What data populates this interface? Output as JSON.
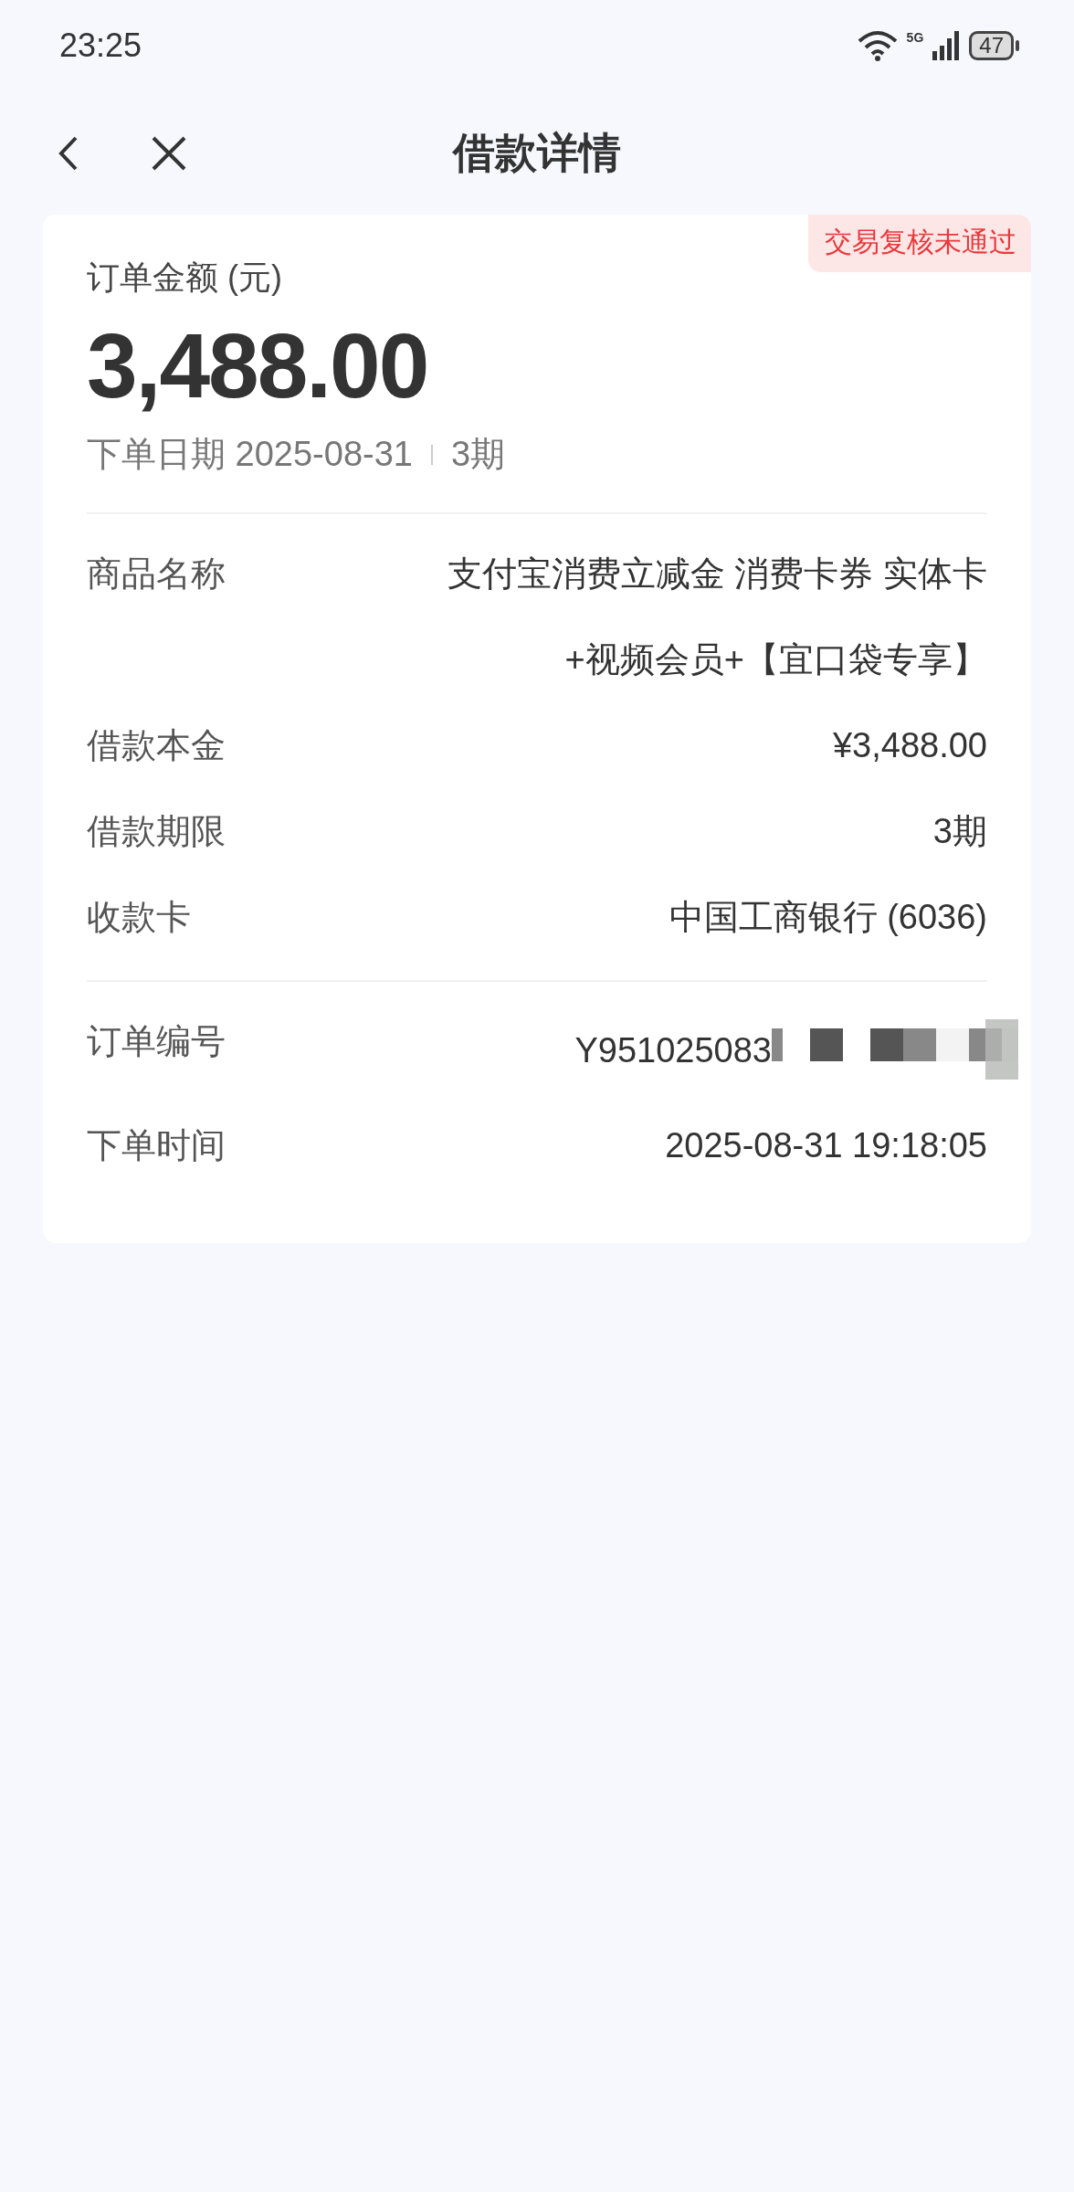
{
  "status_bar": {
    "time": "23:25",
    "network": "5G",
    "battery": "47"
  },
  "header": {
    "title": "借款详情"
  },
  "card": {
    "badge": "交易复核未通过",
    "amount_label": "订单金额 (元)",
    "amount": "3,488.00",
    "date": "下单日期 2025-08-31",
    "term": "3期",
    "details": [
      {
        "label": "商品名称",
        "value": "支付宝消费立减金 消费卡券 实体卡+视频会员+【宜口袋专享】"
      },
      {
        "label": "借款本金",
        "value": "¥3,488.00"
      },
      {
        "label": "借款期限",
        "value": "3期"
      },
      {
        "label": "收款卡",
        "value": "中国工商银行 (6036)"
      }
    ],
    "order": [
      {
        "label": "订单编号",
        "value": "Y951025083",
        "redacted": true
      },
      {
        "label": "下单时间",
        "value": "2025-08-31 19:18:05",
        "redacted": false
      }
    ]
  }
}
